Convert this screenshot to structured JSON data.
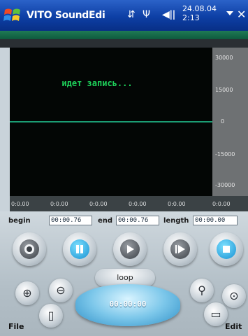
{
  "titlebar": {
    "app_title": "VITO SoundEdi",
    "clock_line1": "24.08.04",
    "clock_line2": "2:13",
    "icons": [
      "windows-start-icon",
      "network-icon",
      "antenna-icon",
      "volume-icon",
      "dropdown-icon",
      "close-icon"
    ]
  },
  "waveform": {
    "status": "идет запись...",
    "db_labels": [
      "30000",
      "15000",
      "0",
      "-15000",
      "-30000"
    ],
    "time_ticks": [
      "0:0.00",
      "0:0.00",
      "0:0.00",
      "0:0.00",
      "0:0.00",
      "0:0.00"
    ]
  },
  "range": {
    "begin_label": "begin",
    "begin_value": "00:00.76",
    "end_label": "end",
    "end_value": "00:00.76",
    "length_label": "length",
    "length_value": "00:00.00"
  },
  "transport": {
    "buttons": [
      "record",
      "pause",
      "play",
      "play-selection",
      "stop"
    ]
  },
  "controls": {
    "loop_label": "loop",
    "timer_value": "00:00:00"
  },
  "softkeys": {
    "left": "File",
    "right": "Edit"
  },
  "colors": {
    "titlebar": "#0d3fa5",
    "status_text": "#1ed15a",
    "wave_line": "#1b9c73",
    "accent_blue": "#1590d2"
  }
}
